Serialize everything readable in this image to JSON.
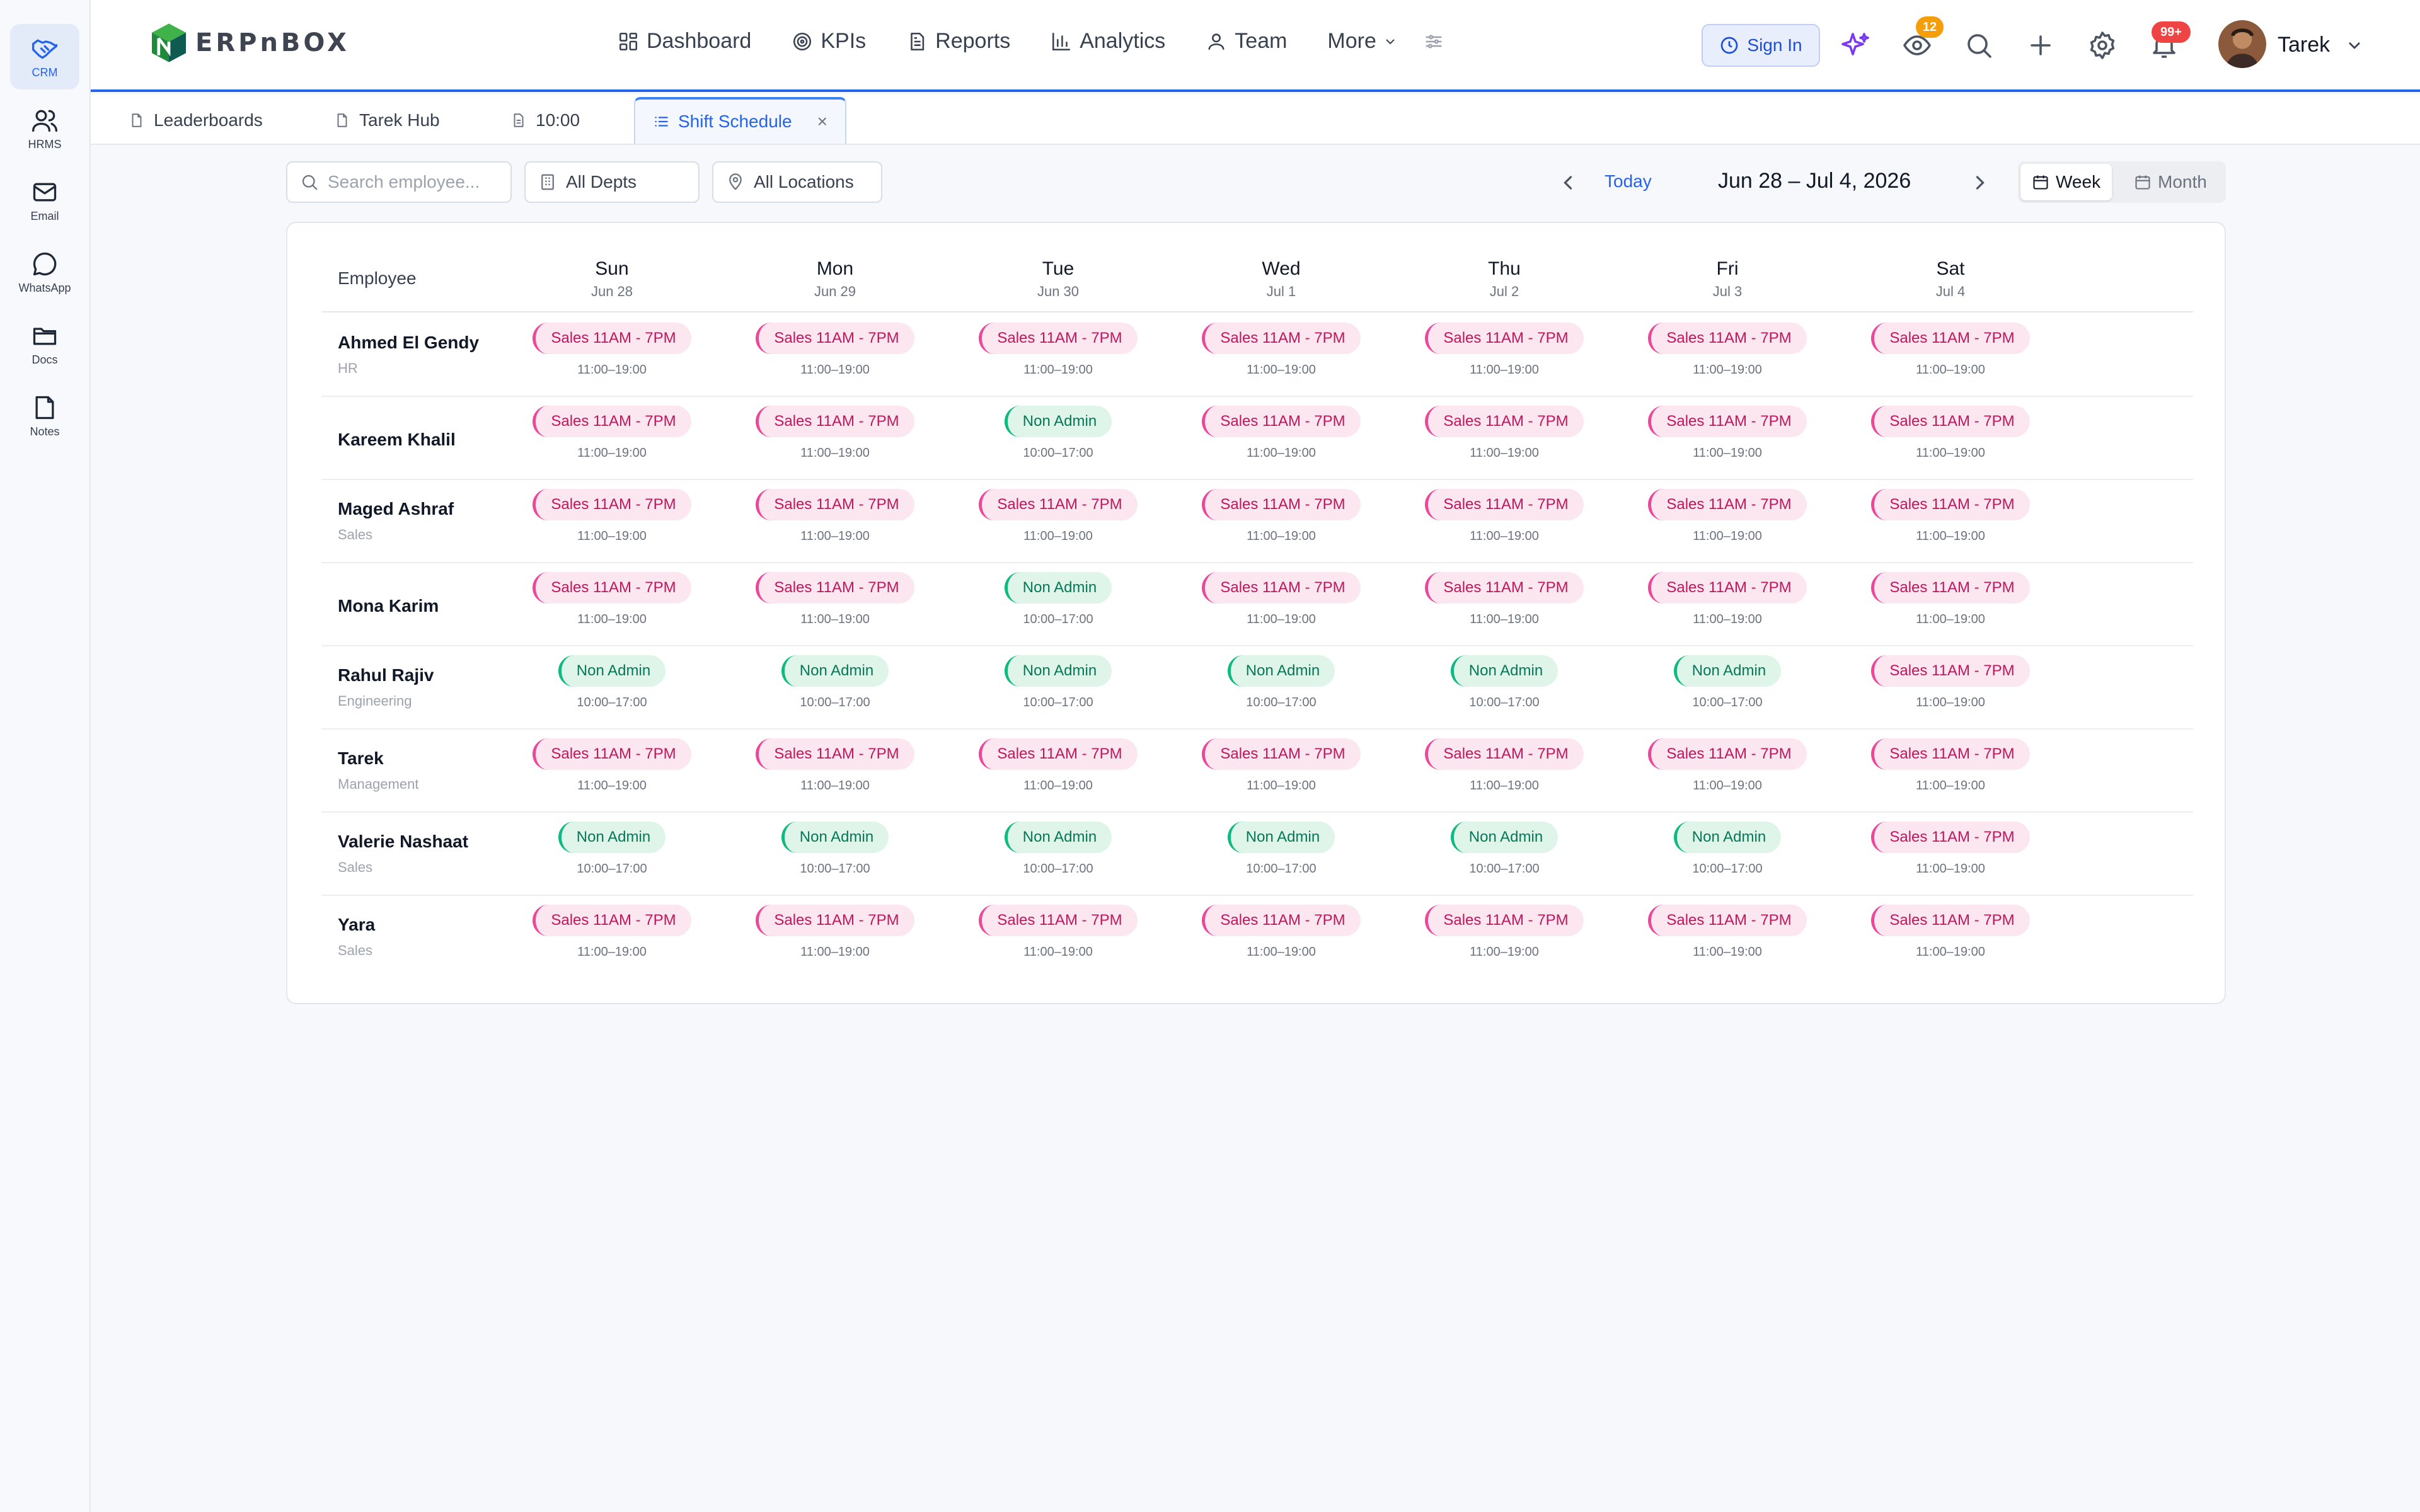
{
  "rail": [
    {
      "label": "CRM",
      "icon": "handshake-icon",
      "active": true
    },
    {
      "label": "HRMS",
      "icon": "users-icon",
      "active": false
    },
    {
      "label": "Email",
      "icon": "mail-icon",
      "active": false
    },
    {
      "label": "WhatsApp",
      "icon": "chat-bubble-icon",
      "active": false
    },
    {
      "label": "Docs",
      "icon": "folder-icon",
      "active": false
    },
    {
      "label": "Notes",
      "icon": "note-icon",
      "active": false
    }
  ],
  "header": {
    "logo_text": "ERPnBOX",
    "nav": [
      {
        "label": "Dashboard",
        "icon": "grid-icon"
      },
      {
        "label": "KPIs",
        "icon": "target-icon"
      },
      {
        "label": "Reports",
        "icon": "report-icon"
      },
      {
        "label": "Analytics",
        "icon": "bar-chart-icon"
      },
      {
        "label": "Team",
        "icon": "user-icon"
      }
    ],
    "more_label": "More",
    "sign_in_label": "Sign In",
    "watch_count": "12",
    "notification_count": "99+",
    "user_name": "Tarek"
  },
  "tabs": [
    {
      "label": "Leaderboards",
      "active": false
    },
    {
      "label": "Tarek Hub",
      "active": false
    },
    {
      "label": "10:00",
      "active": false
    },
    {
      "label": "Shift Schedule",
      "active": true
    }
  ],
  "filters": {
    "search_placeholder": "Search employee...",
    "dept": "All Depts",
    "location": "All Locations"
  },
  "date_nav": {
    "today_label": "Today",
    "range": "Jun 28 – Jul 4, 2026",
    "view_week": "Week",
    "view_month": "Month",
    "active_view": "Week"
  },
  "schedule": {
    "employee_header": "Employee",
    "days": [
      {
        "name": "Sun",
        "date": "Jun 28"
      },
      {
        "name": "Mon",
        "date": "Jun 29"
      },
      {
        "name": "Tue",
        "date": "Jun 30"
      },
      {
        "name": "Wed",
        "date": "Jul 1"
      },
      {
        "name": "Thu",
        "date": "Jul 2"
      },
      {
        "name": "Fri",
        "date": "Jul 3"
      },
      {
        "name": "Sat",
        "date": "Jul 4"
      }
    ],
    "shift_types": {
      "S": {
        "label": "Sales 11AM - 7PM",
        "time": "11:00–19:00",
        "kind": "sales",
        "color": "#be185d"
      },
      "N": {
        "label": "Non Admin",
        "time": "10:00–17:00",
        "kind": "nonadmin",
        "color": "#047857"
      }
    },
    "employees": [
      {
        "name": "Ahmed El Gendy",
        "dept": "HR",
        "shifts": [
          "S",
          "S",
          "S",
          "S",
          "S",
          "S",
          "S"
        ]
      },
      {
        "name": "Kareem Khalil",
        "dept": "",
        "shifts": [
          "S",
          "S",
          "N",
          "S",
          "S",
          "S",
          "S"
        ]
      },
      {
        "name": "Maged Ashraf",
        "dept": "Sales",
        "shifts": [
          "S",
          "S",
          "S",
          "S",
          "S",
          "S",
          "S"
        ]
      },
      {
        "name": "Mona Karim",
        "dept": "",
        "shifts": [
          "S",
          "S",
          "N",
          "S",
          "S",
          "S",
          "S"
        ]
      },
      {
        "name": "Rahul Rajiv",
        "dept": "Engineering",
        "shifts": [
          "N",
          "N",
          "N",
          "N",
          "N",
          "N",
          "S"
        ]
      },
      {
        "name": "Tarek",
        "dept": "Management",
        "shifts": [
          "S",
          "S",
          "S",
          "S",
          "S",
          "S",
          "S"
        ]
      },
      {
        "name": "Valerie Nashaat",
        "dept": "Sales",
        "shifts": [
          "N",
          "N",
          "N",
          "N",
          "N",
          "N",
          "S"
        ]
      },
      {
        "name": "Yara",
        "dept": "Sales",
        "shifts": [
          "S",
          "S",
          "S",
          "S",
          "S",
          "S",
          "S"
        ]
      }
    ]
  },
  "colors": {
    "accent": "#2563eb",
    "sales_pill": "#fce7f1",
    "non_admin_pill": "#dff5ea"
  }
}
